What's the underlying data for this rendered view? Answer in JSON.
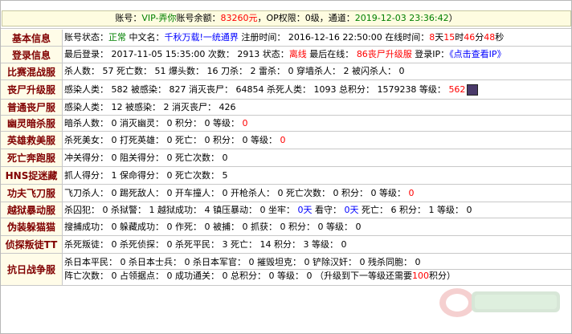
{
  "account": {
    "label_account": "账号：",
    "account_name": "VIP-弄你",
    "label_balance": "账号余额：",
    "balance": "83260元",
    "label_op": "，OP权限：",
    "op_level": "0级",
    "label_channel": "，通道：",
    "channel_time": "2019-12-03 23:36:42",
    "close_paren": "）"
  },
  "rows": [
    {
      "label": "基本信息",
      "segments": [
        {
          "t": "账号状态："
        },
        {
          "t": "正常",
          "c": "green"
        },
        {
          "t": " 中文名："
        },
        {
          "t": "千秋万载!一统通界",
          "c": "blue"
        },
        {
          "t": " 注册时间： 2016-12-16 22:50:00 在线时间："
        },
        {
          "t": "8",
          "c": "red"
        },
        {
          "t": "天"
        },
        {
          "t": "15",
          "c": "red"
        },
        {
          "t": "时"
        },
        {
          "t": "46",
          "c": "red"
        },
        {
          "t": "分"
        },
        {
          "t": "48",
          "c": "red"
        },
        {
          "t": "秒"
        }
      ]
    },
    {
      "label": "登录信息",
      "segments": [
        {
          "t": "最后登录： 2017-11-05 15:35:00 次数： 2913 状态："
        },
        {
          "t": "离线",
          "c": "red"
        },
        {
          "t": " 最后在线： "
        },
        {
          "t": "86丧尸升级服",
          "c": "red"
        },
        {
          "t": " 登录IP："
        },
        {
          "t": "《点击查看IP》",
          "c": "blue",
          "link": true
        }
      ]
    },
    {
      "label": "比赛混战服",
      "segments": [
        {
          "t": "杀人数： 57 死亡数： 51 爆头数： 16 刀杀： 2 雷杀： 0 穿墙杀人： 2 被闪杀人： 0"
        }
      ]
    },
    {
      "label": "丧尸升级服",
      "avatar": true,
      "segments": [
        {
          "t": "感染人类： 582 被感染： 827 消灭丧尸： 64854 杀死人类： 1093 总积分： 1579238 等级： "
        },
        {
          "t": "562",
          "c": "red"
        }
      ]
    },
    {
      "label": "普通丧尸服",
      "segments": [
        {
          "t": "感染人类： 12 被感染： 2 消灭丧尸： 426"
        }
      ]
    },
    {
      "label": "幽灵暗杀服",
      "segments": [
        {
          "t": "暗杀人数： 0 消灭幽灵： 0 积分： 0 等级： "
        },
        {
          "t": "0",
          "c": "red"
        }
      ]
    },
    {
      "label": "英雄救美服",
      "segments": [
        {
          "t": "杀死美女： 0 打死英雄： 0 死亡： 0 积分： 0 等级： "
        },
        {
          "t": "0",
          "c": "red"
        }
      ]
    },
    {
      "label": "死亡奔跑服",
      "segments": [
        {
          "t": "冲关得分： 0 阻关得分： 0 死亡次数： 0"
        }
      ]
    },
    {
      "label": "HNS捉迷藏",
      "segments": [
        {
          "t": "抓人得分： 1 保命得分： 0 死亡次数： 5"
        }
      ]
    },
    {
      "label": "功夫飞刀服",
      "segments": [
        {
          "t": "飞刀杀人： 0 踢死敌人： 0 开车撞人： 0 开枪杀人： 0 死亡次数： 0 积分： 0 等级： "
        },
        {
          "t": "0",
          "c": "red"
        }
      ]
    },
    {
      "label": "越狱暴动服",
      "segments": [
        {
          "t": "杀囚犯： 0 杀狱警： 1 越狱成功： 4 镇压暴动： 0 坐牢： "
        },
        {
          "t": "0天",
          "c": "blue"
        },
        {
          "t": " 看守： "
        },
        {
          "t": "0天",
          "c": "blue"
        },
        {
          "t": " 死亡： 6 积分： 1 等级： 0"
        }
      ]
    },
    {
      "label": "伪装躲猫猫",
      "segments": [
        {
          "t": "搜捕成功： 0 躲藏成功： 0 作死： 0 被捕： 0 抓获： 0 积分： 0 等级： 0"
        }
      ]
    },
    {
      "label": "侦探叛徒TT",
      "segments": [
        {
          "t": "杀死叛徒： 0 杀死侦探： 0 杀死平民： 3 死亡： 14 积分： 3 等级： 0"
        }
      ]
    },
    {
      "label": "抗日战争服",
      "two_lines": true,
      "segments": [
        {
          "t": "杀日本平民： 0 杀日本士兵： 0 杀日本军官： 0 摧毁坦克： 0 铲除汉奸： 0 残杀同胞： 0"
        }
      ],
      "segments2": [
        {
          "t": "阵亡次数： 0 占领据点： 0 成功通关： 0 总积分： 0 等级： 0 （升级到下一等级还需要"
        },
        {
          "t": "100",
          "c": "red"
        },
        {
          "t": "积分）"
        }
      ]
    }
  ]
}
